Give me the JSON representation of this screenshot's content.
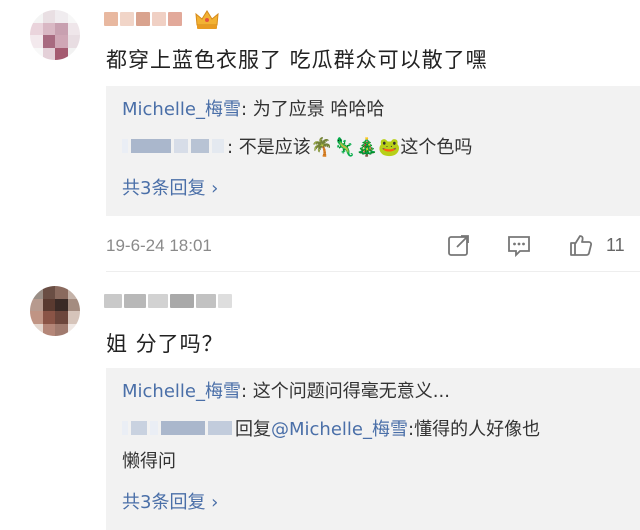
{
  "comments": [
    {
      "text": "都穿上蓝色衣服了 吃瓜群众可以散了嘿",
      "replies": [
        {
          "author": "Michelle_梅雪",
          "text": ": 为了应景 哈哈哈"
        },
        {
          "author": "",
          "text": ": 不是应该🌴🦎🎄🐸这个色吗"
        }
      ],
      "more_replies": "共3条回复 ›",
      "date": "19-6-24 18:01",
      "likes": "11"
    },
    {
      "text": "姐 分了吗？",
      "replies": [
        {
          "author": "Michelle_梅雪",
          "text": ": 这个问题问得毫无意义..."
        },
        {
          "author": "",
          "text_prefix": "回复",
          "mention": "@Michelle_梅雪",
          "text": ":懂得的人好像也",
          "text_cont": "懒得问"
        }
      ],
      "more_replies": "共3条回复 ›"
    }
  ],
  "icons": {
    "badge": "crown-icon",
    "share": "share-icon",
    "reply": "comment-icon",
    "like": "thumbs-up-icon"
  },
  "colors": {
    "link": "#4a6fa8",
    "reply_bg": "#f2f2f2",
    "meta_text": "#8a8a8a"
  }
}
